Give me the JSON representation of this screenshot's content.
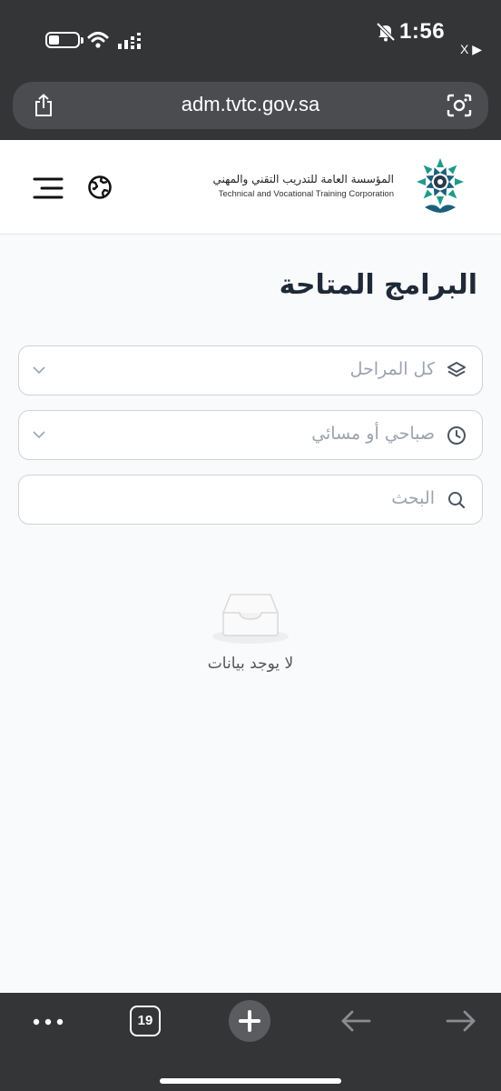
{
  "status_bar": {
    "time": "1:56",
    "back_app": "X ▶"
  },
  "browser": {
    "url": "adm.tvtc.gov.sa",
    "tab_count": "19"
  },
  "header": {
    "logo_ar": "المؤسسة العامة للتدريب التقني والمهني",
    "logo_en": "Technical and Vocational Training Corporation"
  },
  "main": {
    "title": "البرامج المتاحة",
    "filters": {
      "stage": {
        "placeholder": "كل المراحل",
        "icon": "layers-icon"
      },
      "shift": {
        "placeholder": "صباحي أو مسائي",
        "icon": "clock-icon"
      },
      "search": {
        "placeholder": "البحث",
        "icon": "search-icon"
      }
    },
    "empty_text": "لا يوجد بيانات"
  },
  "colors": {
    "chrome": "#333537",
    "page_bg": "#f9fafb",
    "border": "#cfd3d8",
    "placeholder": "#9ca3af",
    "logo_green": "#1f9a8a",
    "logo_teal": "#1b5f7a"
  }
}
